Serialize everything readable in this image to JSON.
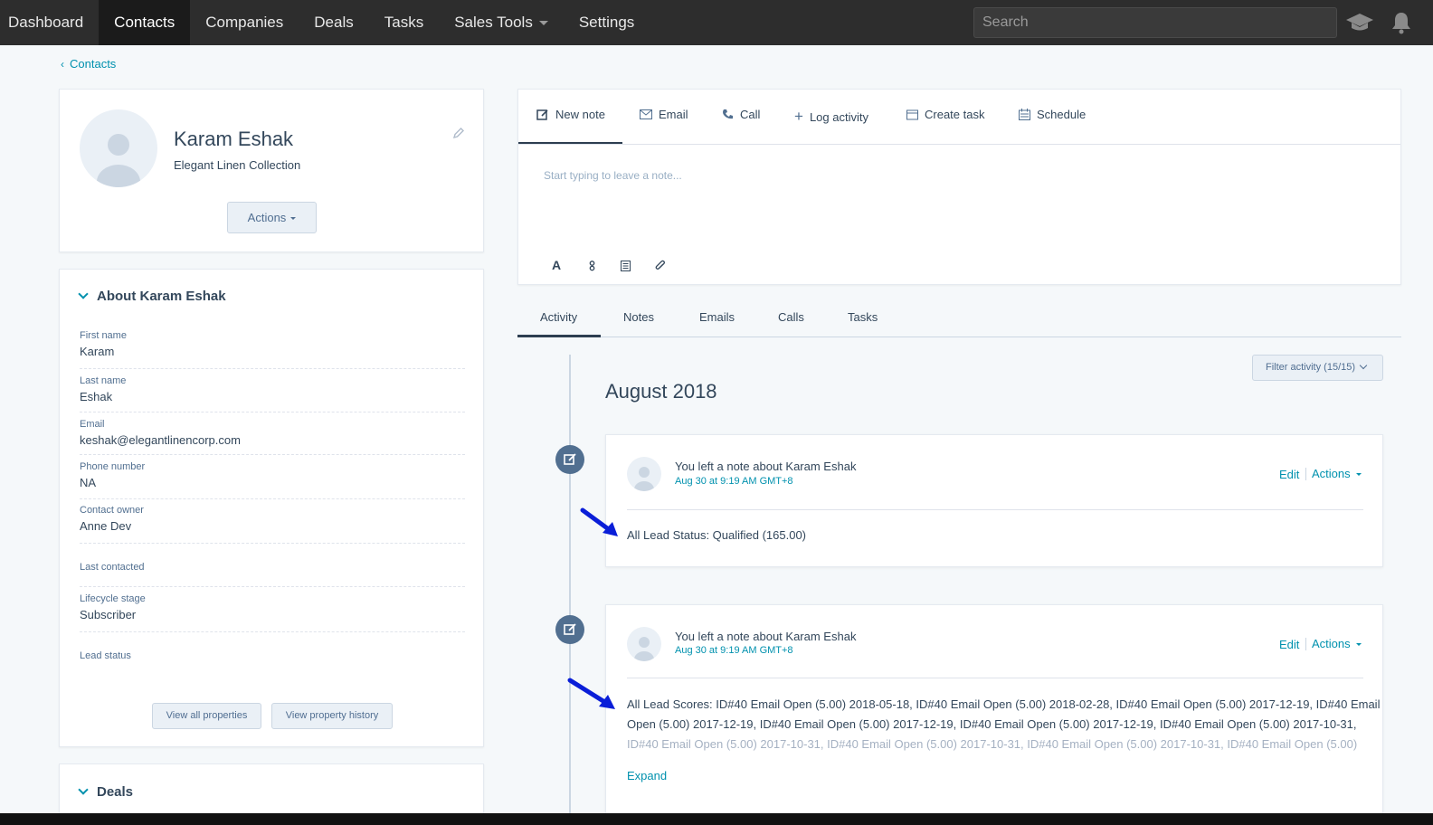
{
  "nav": {
    "items": [
      "Dashboard",
      "Contacts",
      "Companies",
      "Deals",
      "Tasks",
      "Sales Tools",
      "Settings"
    ],
    "active_index": 1,
    "search_placeholder": "Search"
  },
  "breadcrumb": {
    "label": "Contacts"
  },
  "contact": {
    "name": "Karam Eshak",
    "company": "Elegant Linen Collection",
    "actions_label": "Actions"
  },
  "about": {
    "title": "About Karam Eshak",
    "properties": [
      {
        "label": "First name",
        "value": "Karam"
      },
      {
        "label": "Last name",
        "value": "Eshak"
      },
      {
        "label": "Email",
        "value": "keshak@elegantlinencorp.com"
      },
      {
        "label": "Phone number",
        "value": "NA"
      },
      {
        "label": "Contact owner",
        "value": "Anne Dev"
      },
      {
        "label": "Last contacted",
        "value": ""
      },
      {
        "label": "Lifecycle stage",
        "value": "Subscriber"
      },
      {
        "label": "Lead status",
        "value": ""
      }
    ],
    "view_all_label": "View all properties",
    "view_history_label": "View property history"
  },
  "deals": {
    "title": "Deals"
  },
  "composer": {
    "tabs": [
      "New note",
      "Email",
      "Call",
      "Log activity",
      "Create task",
      "Schedule"
    ],
    "active_index": 0,
    "placeholder": "Start typing to leave a note..."
  },
  "activity_tabs": {
    "items": [
      "Activity",
      "Notes",
      "Emails",
      "Calls",
      "Tasks"
    ],
    "active_index": 0
  },
  "filter_label": "Filter activity (15/15)",
  "month_heading": "August 2018",
  "activities": [
    {
      "prefix": "You left a note about ",
      "subject": "Karam Eshak",
      "time": "Aug 30 at 9:19 AM GMT+8",
      "edit_label": "Edit",
      "actions_label": "Actions",
      "body": "All Lead Status: Qualified (165.00)"
    },
    {
      "prefix": "You left a note about ",
      "subject": "Karam Eshak",
      "time": "Aug 30 at 9:19 AM GMT+8",
      "edit_label": "Edit",
      "actions_label": "Actions",
      "body_lines": [
        "All Lead Scores: ID#40 Email Open (5.00) 2018-05-18, ID#40 Email Open (5.00) 2018-02-28, ID#40 Email Open (5.00) 2017-12-19, ID#40 Email",
        "Open (5.00) 2017-12-19, ID#40 Email Open (5.00) 2017-12-19, ID#40 Email Open (5.00) 2017-12-19, ID#40 Email Open (5.00) 2017-10-31,",
        "ID#40 Email Open (5.00) 2017-10-31, ID#40 Email Open (5.00) 2017-10-31, ID#40 Email Open (5.00) 2017-10-31, ID#40 Email Open (5.00)"
      ],
      "expand_label": "Expand"
    }
  ],
  "colors": {
    "nav_bg": "#2d2d2d",
    "accent": "#0091ae",
    "tab_underline": "#2d3e50",
    "annotation_arrow": "#0a1ed8"
  },
  "icons": [
    "graduation-cap-icon",
    "bell-icon",
    "pencil-icon",
    "note-icon",
    "email-icon",
    "phone-icon",
    "plus-icon",
    "task-icon",
    "calendar-icon",
    "text-format-icon",
    "personalize-icon",
    "snippet-icon",
    "attachment-icon"
  ]
}
